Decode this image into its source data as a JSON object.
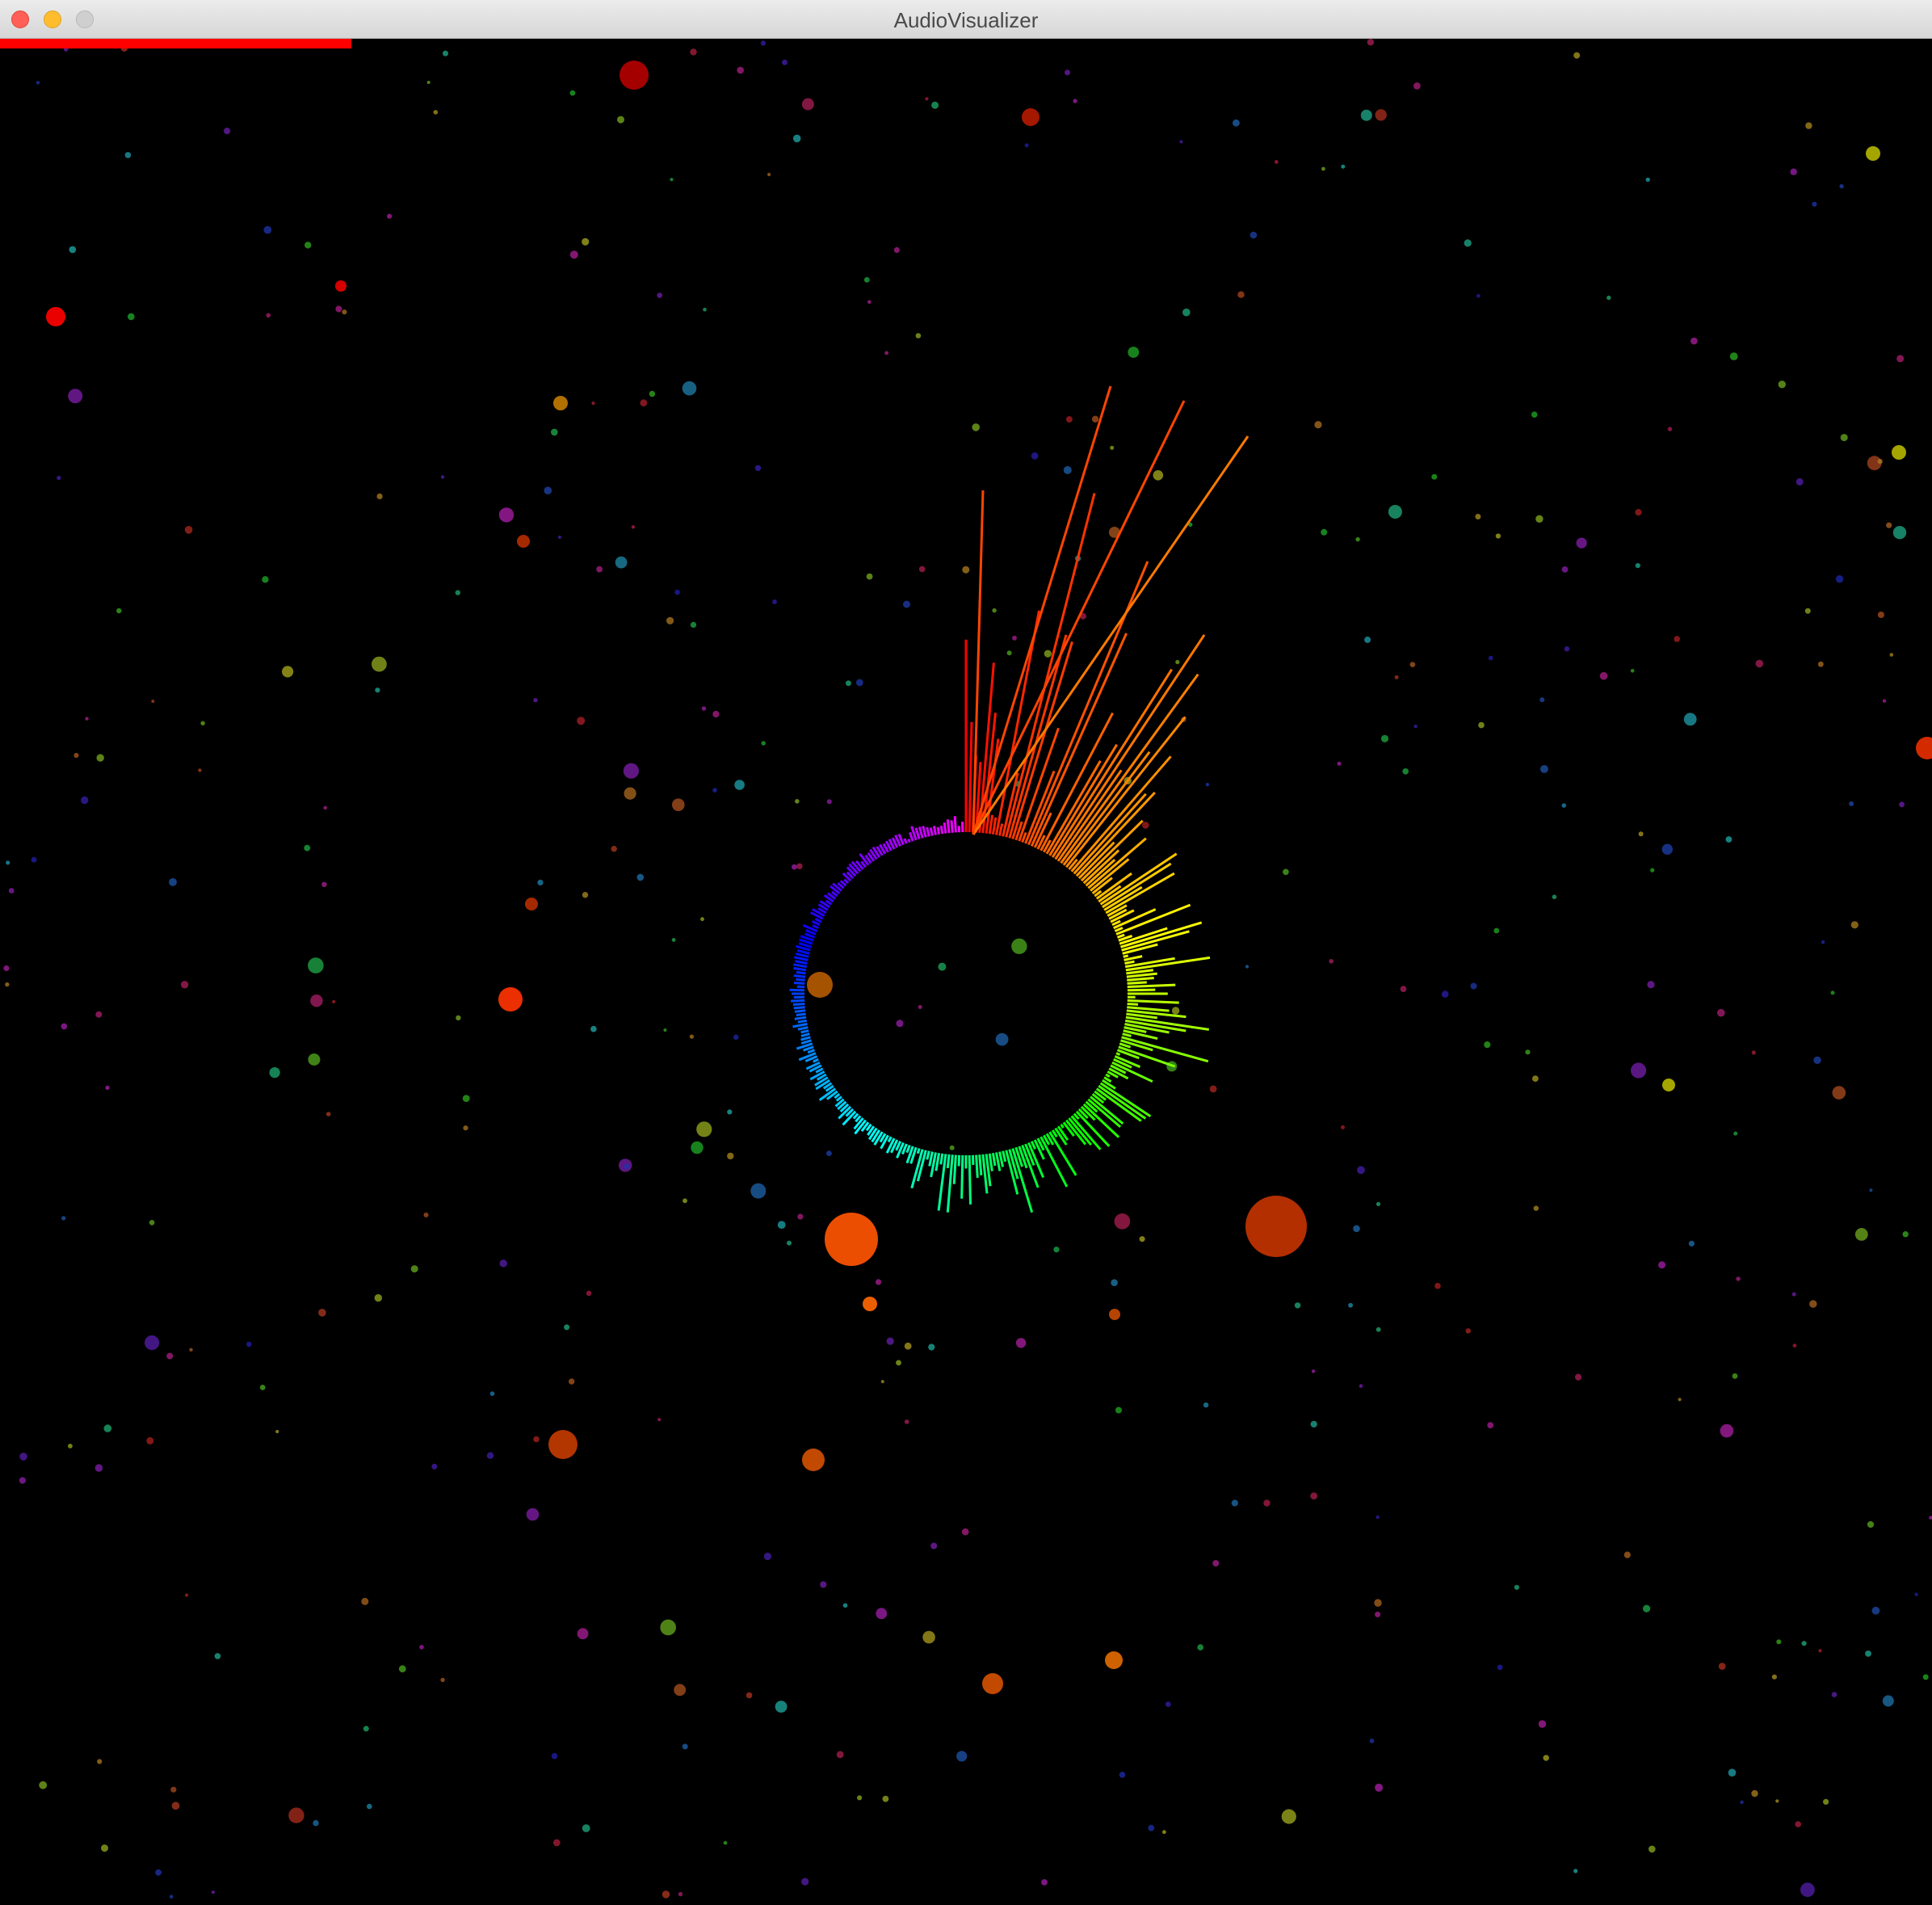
{
  "window": {
    "title": "AudioVisualizer"
  },
  "playback": {
    "progress_fraction": 0.182,
    "progress_color": "#ff0000"
  },
  "visualizer": {
    "background": "#000000",
    "ring_style": "rainbow-radial-spectrum",
    "particle_style": "multicolor-starfield"
  }
}
